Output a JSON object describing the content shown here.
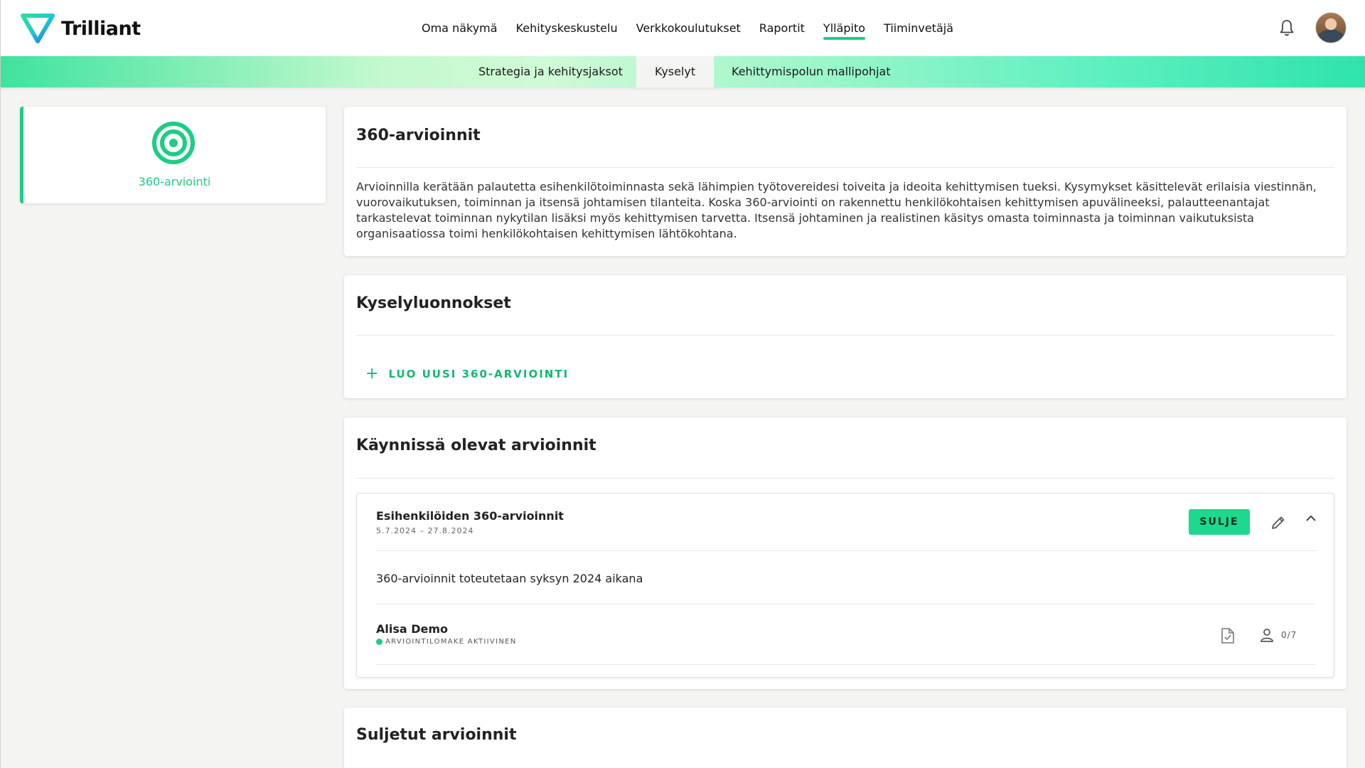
{
  "brand": {
    "name": "Trilliant",
    "accent": "#1fcc83"
  },
  "main_nav": [
    {
      "label": "Oma näkymä",
      "active": false
    },
    {
      "label": "Kehityskeskustelu",
      "active": false
    },
    {
      "label": "Verkkokoulutukset",
      "active": false
    },
    {
      "label": "Raportit",
      "active": false
    },
    {
      "label": "Ylläpito",
      "active": true
    },
    {
      "label": "Tiiminvetäjä",
      "active": false
    }
  ],
  "header_icons": {
    "notifications": "bell-icon",
    "profile": "avatar"
  },
  "sub_nav": [
    {
      "label": "Strategia ja kehitysjaksot",
      "active": false
    },
    {
      "label": "Kyselyt",
      "active": true
    },
    {
      "label": "Kehittymispolun mallipohjat",
      "active": false
    }
  ],
  "sidebar": {
    "label": "360-arviointi",
    "icon": "target-icon"
  },
  "intro": {
    "title": "360-arvioinnit",
    "text": "Arvioinnilla kerätään palautetta esihenkilötoiminnasta sekä lähimpien työtovereidesi toiveita ja ideoita kehittymisen tueksi. Kysymykset käsittelevät erilaisia viestinnän, vuorovaikutuksen, toiminnan ja itsensä johtamisen tilanteita. Koska 360-arviointi on rakennettu henkilökohtaisen kehittymisen apuvälineeksi, palautteenantajat tarkastelevat toiminnan nykytilan lisäksi myös kehittymisen tarvetta. Itsensä johtaminen ja realistinen käsitys omasta toiminnasta ja toiminnan vaikutuksista organisaatiossa toimi henkilökohtaisen kehittymisen lähtökohtana."
  },
  "drafts": {
    "title": "Kyselyluonnokset",
    "create_label": "LUO UUSI 360-ARVIOINTI"
  },
  "ongoing": {
    "title": "Käynnissä olevat arvioinnit",
    "evaluation": {
      "title": "Esihenkilöiden 360-arvioinnit",
      "dates": "5.7.2024 – 27.8.2024",
      "close_label": "SULJE",
      "description": "360-arvioinnit toteutetaan syksyn 2024 aikana",
      "participant": {
        "name": "Alisa Demo",
        "status": "ARVIOINTILOMAKE AKTIIVINEN",
        "count": "0/7"
      }
    }
  },
  "closed": {
    "title": "Suljetut arvioinnit"
  }
}
